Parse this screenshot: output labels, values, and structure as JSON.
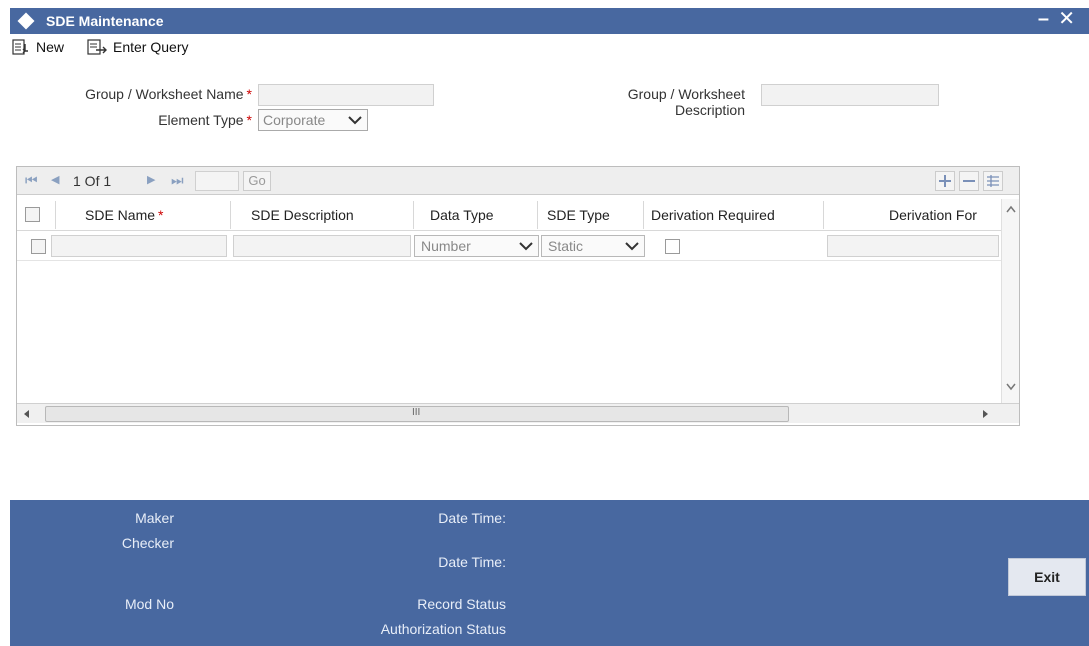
{
  "window": {
    "title": "SDE Maintenance",
    "minimize_glyph": "–",
    "close_glyph": "✕"
  },
  "toolbar": {
    "new_label": "New",
    "enter_query_label": "Enter Query"
  },
  "form": {
    "group_name_label": "Group / Worksheet Name",
    "element_type_label": "Element Type",
    "element_type_value": "Corporate",
    "group_desc_label_line1": "Group / Worksheet",
    "group_desc_label_line2": "Description",
    "required_mark": "*"
  },
  "grid": {
    "pager": {
      "first": "⏮",
      "prev": "◀",
      "text": "1 Of 1",
      "next": "▶",
      "last": "⏭",
      "go_label": "Go"
    },
    "columns": [
      {
        "label": "SDE Name",
        "required": true
      },
      {
        "label": "SDE Description"
      },
      {
        "label": "Data Type"
      },
      {
        "label": "SDE Type"
      },
      {
        "label": "Derivation Required"
      },
      {
        "label": "Derivation For"
      }
    ],
    "row": {
      "data_type_value": "Number",
      "sde_type_value": "Static"
    },
    "hscroll_grip": "III"
  },
  "footer": {
    "maker_label": "Maker",
    "checker_label": "Checker",
    "date_time_label": "Date Time:",
    "date_time_label2": "Date Time:",
    "mod_no_label": "Mod No",
    "record_status_label": "Record Status",
    "authorization_status_label": "Authorization Status",
    "exit_label": "Exit"
  },
  "colors": {
    "title_bar": "#4868a0",
    "footer": "#4868a0",
    "required": "#cc0000"
  }
}
